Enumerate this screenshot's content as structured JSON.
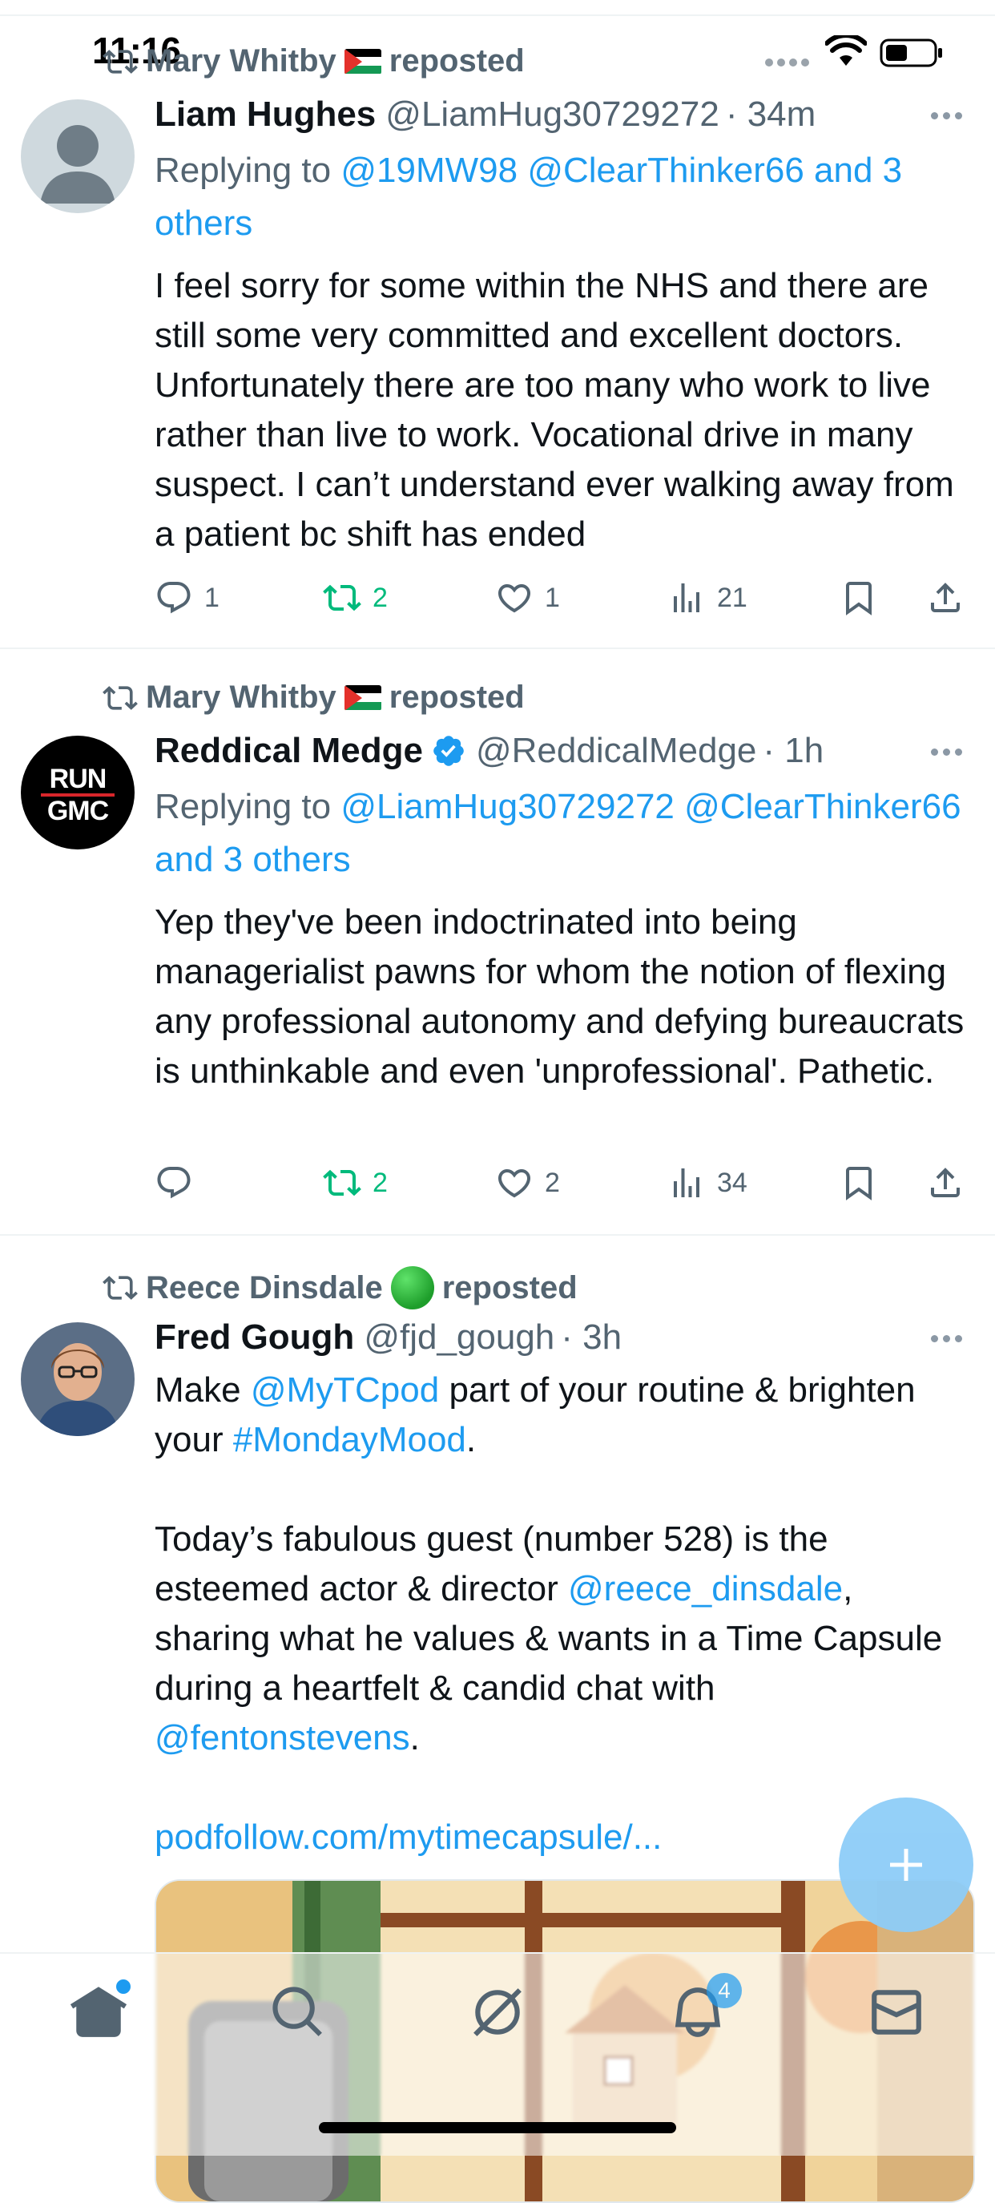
{
  "status_bar": {
    "time": "11:16"
  },
  "tweets": [
    {
      "repost_by": "Mary Whitby",
      "repost_suffix": "reposted",
      "display_name": "Liam Hughes",
      "handle": "@LiamHug30729272",
      "time": "· 34m",
      "reply_prefix": "Replying to",
      "reply_to": "@19MW98 @ClearThinker66 and 3 others",
      "text": "I feel sorry for some within the NHS and there are still some very committed and excellent doctors. Unfortunately there are too many who work to live rather than live to work. Vocational drive in many suspect. I can’t understand ever walking away from a patient bc shift has ended",
      "replies": "1",
      "reposts": "2",
      "likes": "1",
      "views": "21"
    },
    {
      "repost_by": "Mary Whitby",
      "repost_suffix": "reposted",
      "display_name": "Reddical Medge",
      "handle": "@ReddicalMedge",
      "time": "· 1h",
      "reply_prefix": "Replying to",
      "reply_to": "@LiamHug30729272 @ClearThinker66 and 3 others",
      "text": "Yep they've been indoctrinated into being managerialist pawns for whom the notion of flexing any professional autonomy and defying bureaucrats is unthinkable and even 'unprofessional'. Pathetic.",
      "replies": "",
      "reposts": "2",
      "likes": "2",
      "views": "34",
      "avatar_text_1": "RUN",
      "avatar_text_2": "GMC"
    },
    {
      "repost_by": "Reece Dinsdale",
      "repost_suffix": "reposted",
      "display_name": "Fred Gough",
      "handle": "@fjd_gough",
      "time": "· 3h",
      "text_p1_a": "Make ",
      "text_p1_link": "@MyTCpod",
      "text_p1_b": " part of your routine & brighten your ",
      "text_p1_tag": "#MondayMood",
      "text_p1_c": ".",
      "text_p2_a": "Today’s fabulous guest (number 528) is the esteemed actor & director ",
      "text_p2_link1": "@reece_dinsdale",
      "text_p2_b": ", sharing what he values & wants in a Time Capsule during a heartfelt & candid chat with ",
      "text_p2_link2": "@fentonstevens",
      "text_p2_c": ".",
      "url": "podfollow.com/mytimecapsule/..."
    }
  ],
  "bottom_nav": {
    "notifications_count": "4"
  },
  "colors": {
    "link": "#1d9bf0",
    "secondary": "#536471",
    "repost_green": "#00ba7c"
  }
}
